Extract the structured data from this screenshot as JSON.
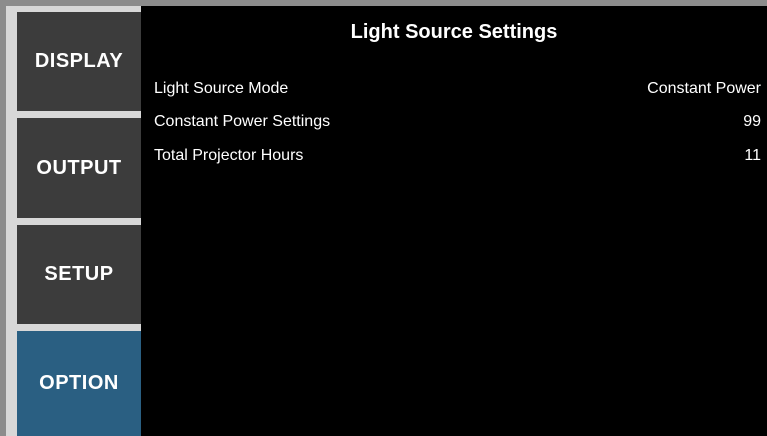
{
  "sidebar": {
    "items": [
      {
        "label": "DISPLAY",
        "active": false
      },
      {
        "label": "OUTPUT",
        "active": false
      },
      {
        "label": "SETUP",
        "active": false
      },
      {
        "label": "OPTION",
        "active": true
      }
    ]
  },
  "main": {
    "title": "Light Source Settings",
    "rows": [
      {
        "label": "Light Source Mode",
        "value": "Constant Power"
      },
      {
        "label": "Constant Power Settings",
        "value": "99"
      },
      {
        "label": "Total Projector Hours",
        "value": "11"
      }
    ]
  },
  "colors": {
    "active_tab": "#2a5f82",
    "inactive_tab": "#3c3c3c",
    "content_bg": "#000000",
    "frame": "#8c8c8c"
  }
}
